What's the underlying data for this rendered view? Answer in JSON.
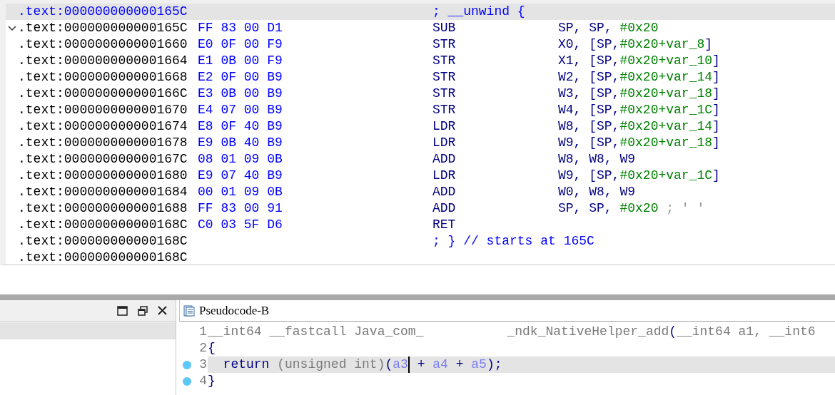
{
  "disassembly": {
    "rows": [
      {
        "kind": "header",
        "selected": true,
        "expanded": false,
        "address": ".text:000000000000165C",
        "bytes": "",
        "mnemonic": "",
        "operands": [
          {
            "text": "; __unwind {",
            "kind": "comment"
          }
        ]
      },
      {
        "kind": "instruction",
        "selected": false,
        "expanded": true,
        "address": ".text:000000000000165C",
        "bytes": "FF 83 00 D1",
        "mnemonic": "SUB",
        "operands": [
          {
            "text": "SP, SP, ",
            "kind": "reg"
          },
          {
            "text": "#0x20",
            "kind": "num"
          }
        ]
      },
      {
        "kind": "instruction",
        "selected": false,
        "expanded": false,
        "address": ".text:0000000000001660",
        "bytes": "E0 0F 00 F9",
        "mnemonic": "STR",
        "operands": [
          {
            "text": "X0, [SP,",
            "kind": "reg"
          },
          {
            "text": "#0x20+var_8",
            "kind": "num"
          },
          {
            "text": "]",
            "kind": "reg"
          }
        ]
      },
      {
        "kind": "instruction",
        "selected": false,
        "expanded": false,
        "address": ".text:0000000000001664",
        "bytes": "E1 0B 00 F9",
        "mnemonic": "STR",
        "operands": [
          {
            "text": "X1, [SP,",
            "kind": "reg"
          },
          {
            "text": "#0x20+var_10",
            "kind": "num"
          },
          {
            "text": "]",
            "kind": "reg"
          }
        ]
      },
      {
        "kind": "instruction",
        "selected": false,
        "expanded": false,
        "address": ".text:0000000000001668",
        "bytes": "E2 0F 00 B9",
        "mnemonic": "STR",
        "operands": [
          {
            "text": "W2, [SP,",
            "kind": "reg"
          },
          {
            "text": "#0x20+var_14",
            "kind": "num"
          },
          {
            "text": "]",
            "kind": "reg"
          }
        ]
      },
      {
        "kind": "instruction",
        "selected": false,
        "expanded": false,
        "address": ".text:000000000000166C",
        "bytes": "E3 0B 00 B9",
        "mnemonic": "STR",
        "operands": [
          {
            "text": "W3, [SP,",
            "kind": "reg"
          },
          {
            "text": "#0x20+var_18",
            "kind": "num"
          },
          {
            "text": "]",
            "kind": "reg"
          }
        ]
      },
      {
        "kind": "instruction",
        "selected": false,
        "expanded": false,
        "address": ".text:0000000000001670",
        "bytes": "E4 07 00 B9",
        "mnemonic": "STR",
        "operands": [
          {
            "text": "W4, [SP,",
            "kind": "reg"
          },
          {
            "text": "#0x20+var_1C",
            "kind": "num"
          },
          {
            "text": "]",
            "kind": "reg"
          }
        ]
      },
      {
        "kind": "instruction",
        "selected": false,
        "expanded": false,
        "address": ".text:0000000000001674",
        "bytes": "E8 0F 40 B9",
        "mnemonic": "LDR",
        "operands": [
          {
            "text": "W8, [SP,",
            "kind": "reg"
          },
          {
            "text": "#0x20+var_14",
            "kind": "num"
          },
          {
            "text": "]",
            "kind": "reg"
          }
        ]
      },
      {
        "kind": "instruction",
        "selected": false,
        "expanded": false,
        "address": ".text:0000000000001678",
        "bytes": "E9 0B 40 B9",
        "mnemonic": "LDR",
        "operands": [
          {
            "text": "W9, [SP,",
            "kind": "reg"
          },
          {
            "text": "#0x20+var_18",
            "kind": "num"
          },
          {
            "text": "]",
            "kind": "reg"
          }
        ]
      },
      {
        "kind": "instruction",
        "selected": false,
        "expanded": false,
        "address": ".text:000000000000167C",
        "bytes": "08 01 09 0B",
        "mnemonic": "ADD",
        "operands": [
          {
            "text": "W8, W8, W9",
            "kind": "reg"
          }
        ]
      },
      {
        "kind": "instruction",
        "selected": false,
        "expanded": false,
        "address": ".text:0000000000001680",
        "bytes": "E9 07 40 B9",
        "mnemonic": "LDR",
        "operands": [
          {
            "text": "W9, [SP,",
            "kind": "reg"
          },
          {
            "text": "#0x20+var_1C",
            "kind": "num"
          },
          {
            "text": "]",
            "kind": "reg"
          }
        ]
      },
      {
        "kind": "instruction",
        "selected": false,
        "expanded": false,
        "address": ".text:0000000000001684",
        "bytes": "00 01 09 0B",
        "mnemonic": "ADD",
        "operands": [
          {
            "text": "W0, W8, W9",
            "kind": "reg"
          }
        ]
      },
      {
        "kind": "instruction",
        "selected": false,
        "expanded": false,
        "address": ".text:0000000000001688",
        "bytes": "FF 83 00 91",
        "mnemonic": "ADD",
        "operands": [
          {
            "text": "SP, SP, ",
            "kind": "reg"
          },
          {
            "text": "#0x20",
            "kind": "num"
          },
          {
            "text": " ; ' '",
            "kind": "note"
          }
        ]
      },
      {
        "kind": "instruction",
        "selected": false,
        "expanded": false,
        "address": ".text:000000000000168C",
        "bytes": "C0 03 5F D6",
        "mnemonic": "RET",
        "operands": []
      },
      {
        "kind": "footer",
        "selected": false,
        "expanded": false,
        "address": ".text:000000000000168C",
        "bytes": "",
        "mnemonic": "",
        "operands": [
          {
            "text": "; } // starts at 165C",
            "kind": "comment"
          }
        ]
      },
      {
        "kind": "plain",
        "selected": false,
        "expanded": false,
        "address": ".text:000000000000168C",
        "bytes": "",
        "mnemonic": "",
        "operands": []
      }
    ]
  },
  "pseudocode": {
    "tab": {
      "title": "Pseudocode-B"
    },
    "lines": [
      {
        "number": "1",
        "breakpoint": false,
        "selected": false,
        "tokens": [
          {
            "text": "__int64 __fastcall Java_com_",
            "kind": "plain"
          },
          {
            "text": "_ndk_NativeHelper_add",
            "kind": "plain",
            "gap_before": true
          },
          {
            "text": "(",
            "kind": "punct"
          },
          {
            "text": "__int64 a1, __int6",
            "kind": "plain"
          }
        ]
      },
      {
        "number": "2",
        "breakpoint": false,
        "selected": false,
        "tokens": [
          {
            "text": "{",
            "kind": "punct"
          }
        ]
      },
      {
        "number": "3",
        "breakpoint": true,
        "selected": true,
        "tokens": [
          {
            "text": "  return ",
            "kind": "punct"
          },
          {
            "text": "(unsigned int)",
            "kind": "plain"
          },
          {
            "text": "(",
            "kind": "punct"
          },
          {
            "text": "a3",
            "kind": "var",
            "cursor_after": true
          },
          {
            "text": " + ",
            "kind": "punct"
          },
          {
            "text": "a4",
            "kind": "var"
          },
          {
            "text": " + ",
            "kind": "punct"
          },
          {
            "text": "a5",
            "kind": "var"
          },
          {
            "text": ");",
            "kind": "punct"
          }
        ]
      },
      {
        "number": "4",
        "breakpoint": true,
        "selected": false,
        "tokens": [
          {
            "text": "}",
            "kind": "punct"
          }
        ]
      }
    ]
  }
}
